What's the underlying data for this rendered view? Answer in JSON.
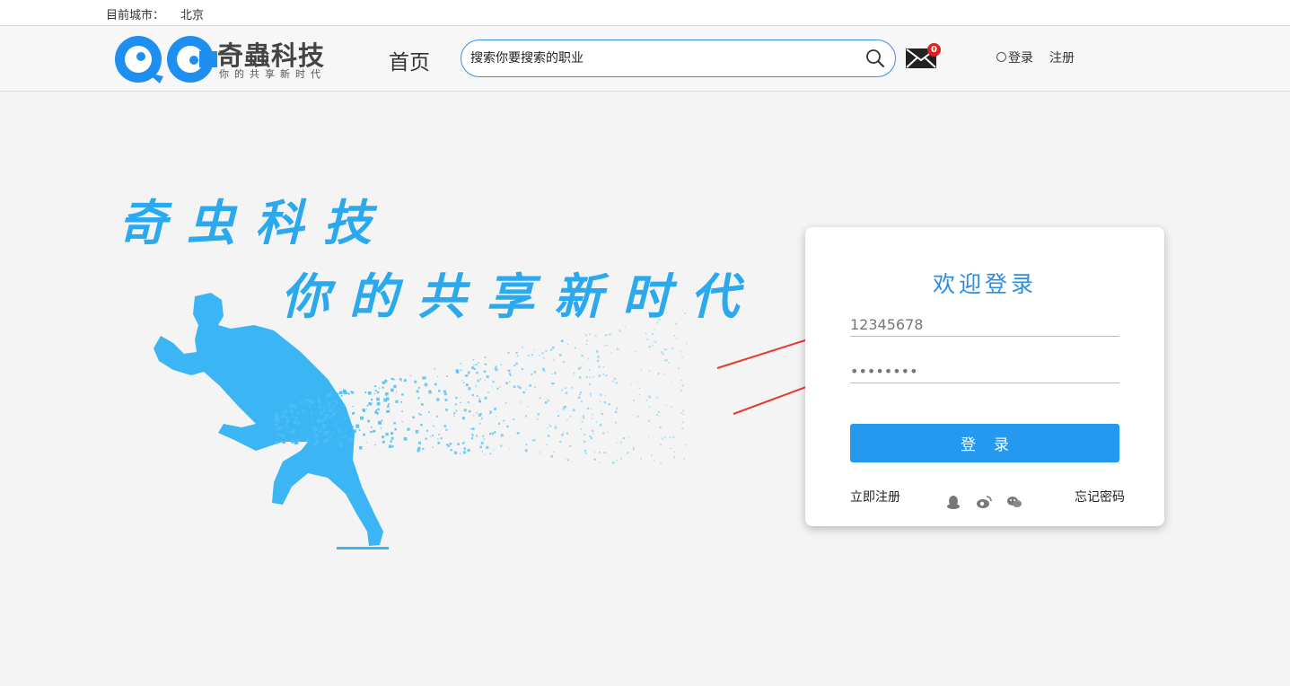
{
  "city_bar": {
    "label": "目前城市：",
    "value": "北京"
  },
  "header": {
    "logo_main": "奇蟲科技",
    "logo_sub": "你的共享新时代",
    "nav_home": "首页",
    "search_placeholder": "搜索你要搜索的职业",
    "mail_count": "0",
    "login": "登录",
    "register": "注册"
  },
  "hero": {
    "slogan_line1": "奇虫科技",
    "slogan_line2": "你的共享新时代"
  },
  "login_card": {
    "title": "欢迎登录",
    "username_value": "12345678",
    "password_value": "********",
    "submit": "登录",
    "register_now": "立即注册",
    "forgot_password": "忘记密码",
    "social": [
      "qq-icon",
      "weibo-icon",
      "wechat-icon"
    ]
  },
  "colors": {
    "accent": "#2598f0",
    "slogan": "#2aa9ef",
    "title": "#2e8de0",
    "arrow": "#e63a2e"
  }
}
